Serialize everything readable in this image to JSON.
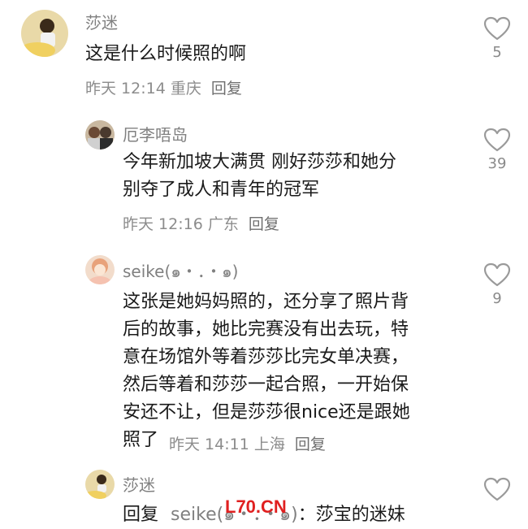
{
  "comments": [
    {
      "name": "莎迷",
      "lines": [
        "这是什么时候照的啊"
      ],
      "time": "昨天 12:14",
      "location": "重庆",
      "reply_label": "回复",
      "likes": "5"
    },
    {
      "name": "厄李唔岛",
      "lines": [
        "今年新加坡大满贯 刚好莎莎和她分",
        "别夺了成人和青年的冠军"
      ],
      "time": "昨天 12:16",
      "location": "广东",
      "reply_label": "回复",
      "likes": "39"
    },
    {
      "name": "seike(๑・．・๑)",
      "lines": [
        "这张是她妈妈照的，还分享了照片背",
        "后的故事，她比完赛没有出去玩，特",
        "意在场馆外等着莎莎比完女单决赛，",
        "然后等着和莎莎一起合照，一开始保",
        "安还不让，但是莎莎很nice还是跟她"
      ],
      "last_line": "照了",
      "time": "昨天 14:11",
      "location": "上海",
      "reply_label": "回复",
      "likes": "9"
    },
    {
      "name": "莎迷",
      "reply_prefix": "回复",
      "reply_to": "seike(๑・．・๑)",
      "reply_text": "：莎宝的迷妹"
    }
  ],
  "watermark": "L70.CN",
  "colors": {
    "like_icon": "#9a9a9a",
    "watermark": "#e02020"
  }
}
